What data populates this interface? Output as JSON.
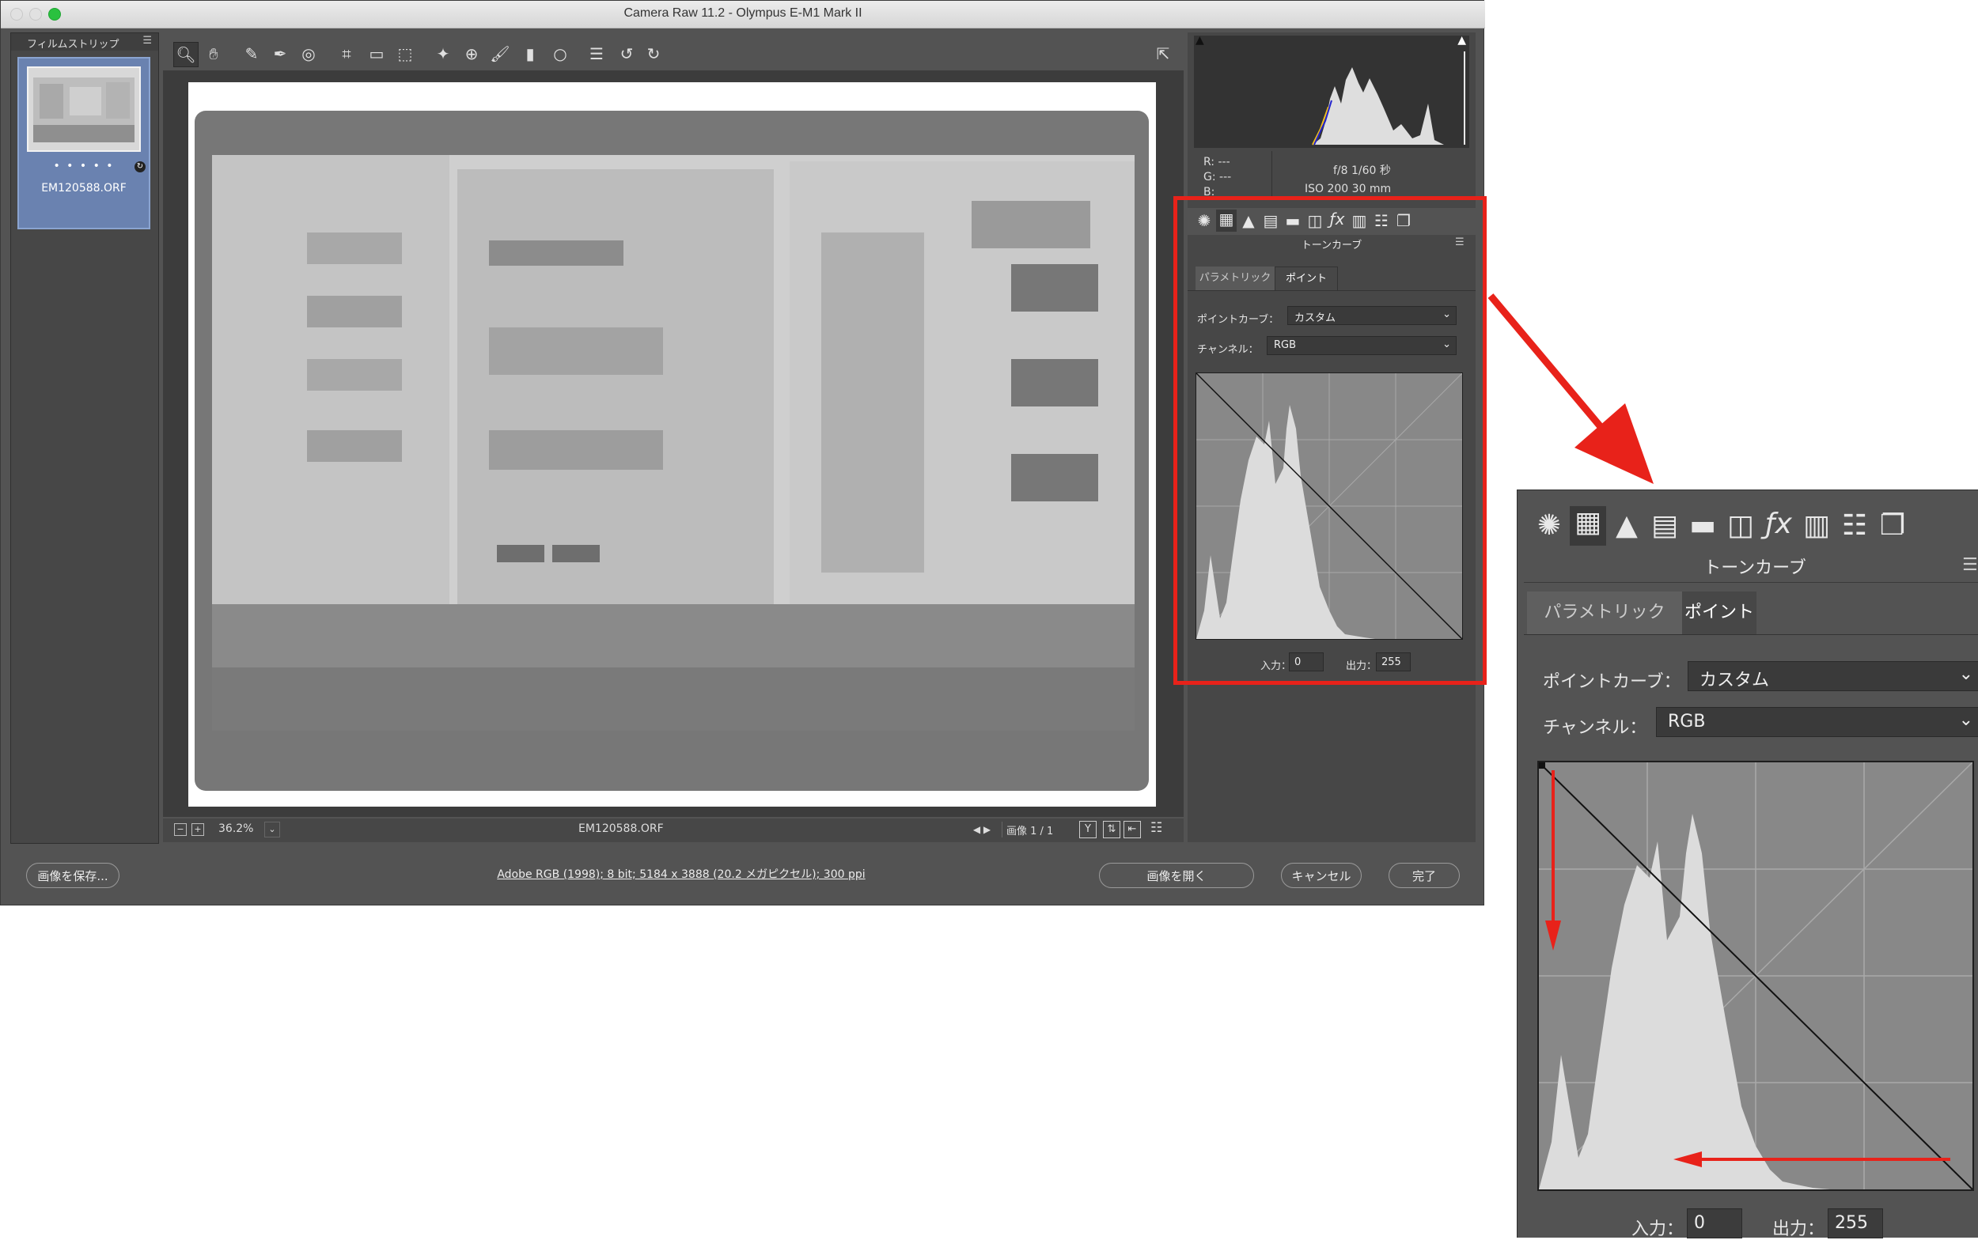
{
  "window": {
    "title": "Camera Raw 11.2 - Olympus E-M1 Mark II"
  },
  "filmstrip": {
    "header": "フィルムストリップ",
    "thumb_rating": "• • • • •",
    "filename": "EM120588.ORF"
  },
  "statusbar": {
    "zoom": "36.2%",
    "filename": "EM120588.ORF",
    "image_counter": "画像 1 / 1"
  },
  "readout": {
    "r": "R:  ---",
    "g": "G:  ---",
    "b": "B:",
    "aperture_shutter": "f/8    1/60 秒",
    "iso_focal": "ISO 200    30 mm"
  },
  "panel": {
    "title": "トーンカーブ",
    "tab_parametric": "パラメトリック",
    "tab_point": "ポイント",
    "point_curve_label": "ポイントカーブ：",
    "point_curve_value": "カスタム",
    "channel_label": "チャンネル：",
    "channel_value": "RGB",
    "input_label": "入力：",
    "input_value": "0",
    "output_label": "出力：",
    "output_value": "255"
  },
  "buttons": {
    "save": "画像を保存...",
    "open": "画像を開く",
    "cancel": "キャンセル",
    "done": "完了"
  },
  "workflow_link": "Adobe RGB (1998); 8 bit; 5184 x 3888 (20.2 メガピクセル); 300 ppi",
  "colors": {
    "highlight": "#e8221a",
    "panel_bg": "#474747",
    "window_bg": "#535353"
  }
}
